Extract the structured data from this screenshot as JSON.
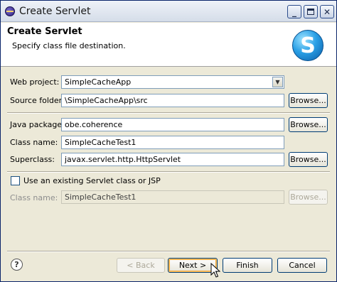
{
  "window": {
    "title": "Create Servlet",
    "minimize": "_",
    "close": "✕"
  },
  "header": {
    "title": "Create Servlet",
    "description": "Specify class file destination.",
    "logo_letter": "S"
  },
  "form": {
    "web_project": {
      "label": "Web project:",
      "value": "SimpleCacheApp"
    },
    "source_folder": {
      "label": "Source folder:",
      "value": "\\SimpleCacheApp\\src",
      "browse": "Browse..."
    },
    "java_package": {
      "label": "Java package:",
      "value": "obe.coherence",
      "browse": "Browse..."
    },
    "class_name": {
      "label": "Class name:",
      "value": "SimpleCacheTest1"
    },
    "superclass": {
      "label": "Superclass:",
      "value": "javax.servlet.http.HttpServlet",
      "browse": "Browse..."
    },
    "existing": {
      "label": "Use an existing Servlet class or JSP",
      "checked": false
    },
    "existing_class": {
      "label": "Class name:",
      "value": "SimpleCacheTest1",
      "browse": "Browse..."
    }
  },
  "footer": {
    "help": "?",
    "back": "< Back",
    "next": "Next >",
    "finish": "Finish",
    "cancel": "Cancel"
  }
}
